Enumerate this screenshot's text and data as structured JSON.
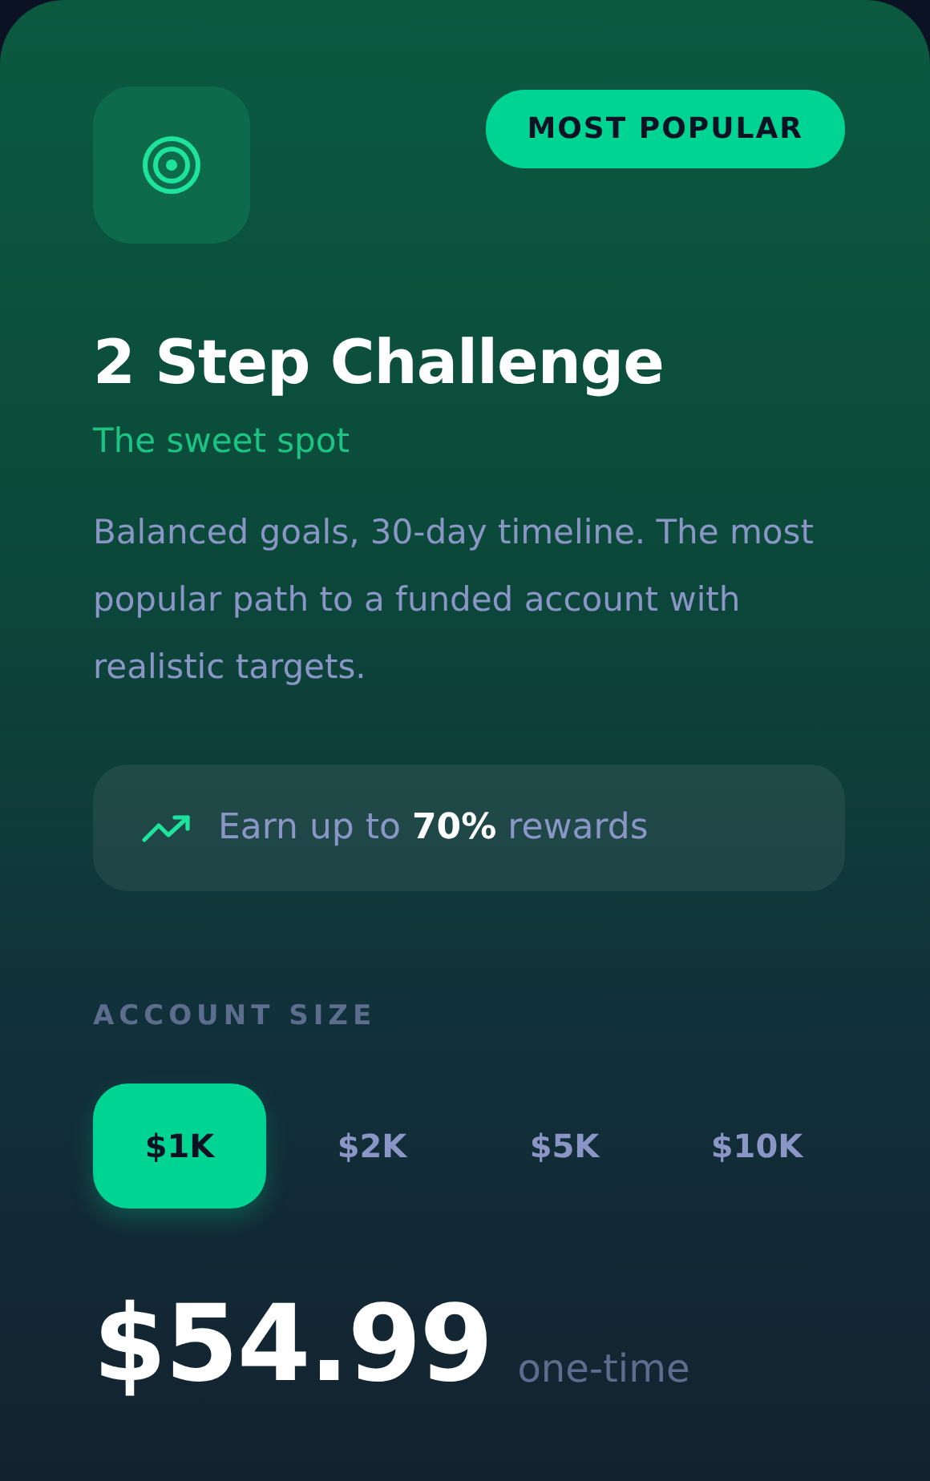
{
  "badge": "MOST POPULAR",
  "title": "2 Step Challenge",
  "subtitle": "The sweet spot",
  "description": "Balanced goals, 30-day timeline. The most popular path to a funded account with realistic targets.",
  "reward": "Earn up to **70%** rewards",
  "account_size": {
    "label": "ACCOUNT SIZE",
    "options": [
      {
        "label": "$1K",
        "selected": true
      },
      {
        "label": "$2K",
        "selected": false
      },
      {
        "label": "$5K",
        "selected": false
      },
      {
        "label": "$10K",
        "selected": false
      }
    ]
  },
  "price": {
    "amount": "$54.99",
    "note": "one-time"
  }
}
